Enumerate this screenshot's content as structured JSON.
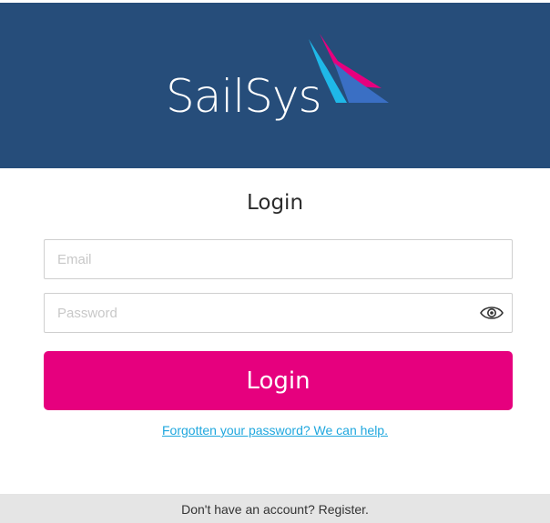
{
  "brand": {
    "name": "SailSys",
    "header_color": "#264d7a",
    "sail_colors": [
      "#1fb8e8",
      "#e6007e",
      "#3a6fc4"
    ]
  },
  "form": {
    "title": "Login",
    "email_placeholder": "Email",
    "password_placeholder": "Password",
    "show_password_icon": "eye-icon",
    "submit_label": "Login",
    "submit_color": "#e6007e"
  },
  "links": {
    "forgot_password": "Forgotten your password? We can help."
  },
  "footer": {
    "register_text": "Don't have an account? Register."
  }
}
